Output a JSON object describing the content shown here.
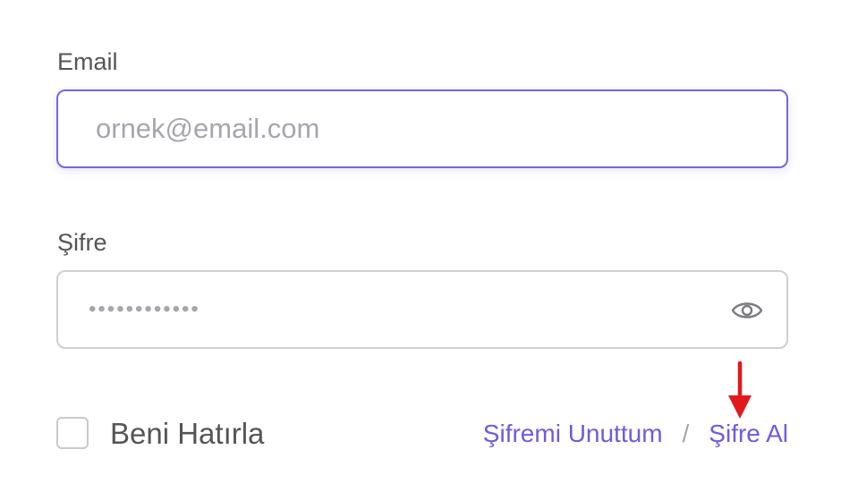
{
  "form": {
    "email_label": "Email",
    "email_placeholder": "ornek@email.com",
    "email_value": "",
    "password_label": "Şifre",
    "password_placeholder": "••••••••••••",
    "password_value": "",
    "remember_label": "Beni Hatırla",
    "remember_checked": false,
    "forgot_link": "Şifremi Unuttum",
    "separator": "/",
    "get_password_link": "Şifre Al"
  },
  "icons": {
    "password_toggle": "eye-icon",
    "annotation": "red-arrow-down-icon"
  },
  "colors": {
    "accent": "#6f5bdc",
    "focus_border": "#7766e0",
    "annotation": "#e0191c",
    "label": "#555555",
    "placeholder": "#a6a6ad"
  }
}
